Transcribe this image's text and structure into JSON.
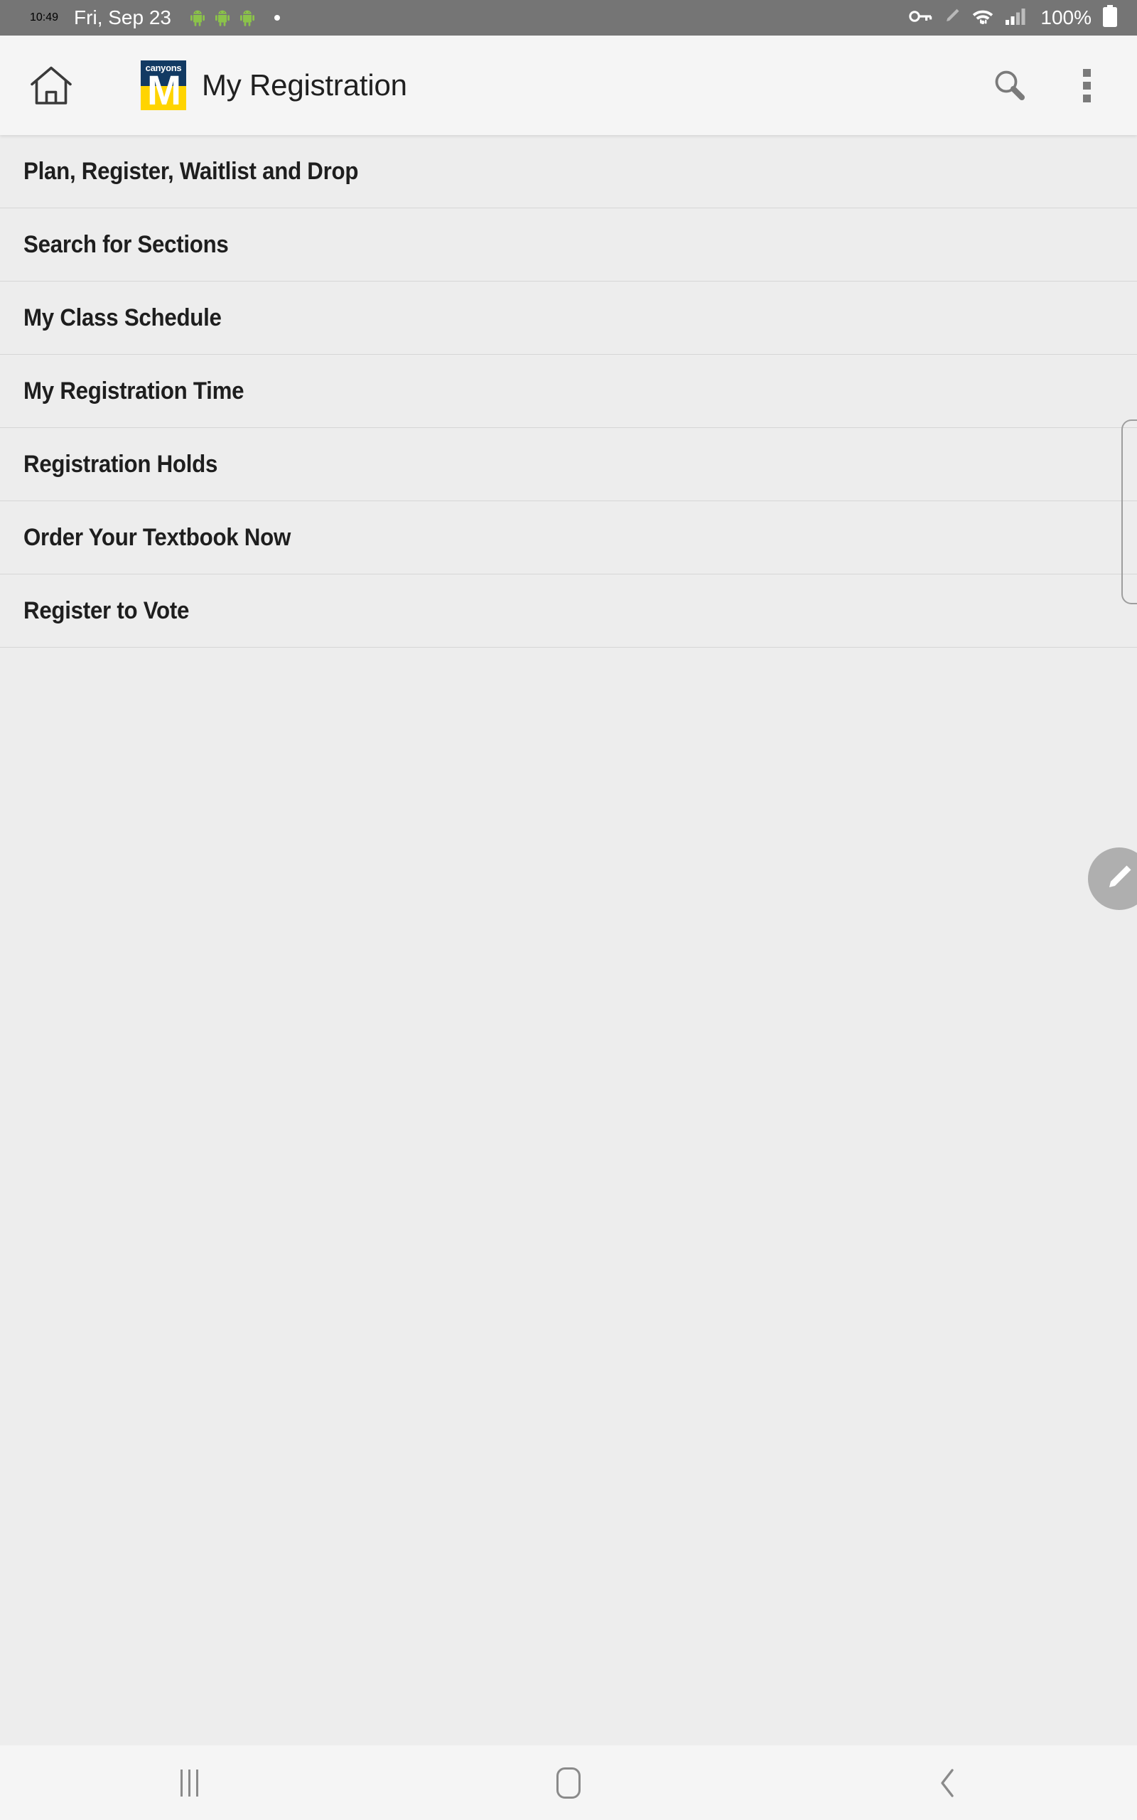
{
  "status_bar": {
    "time": "10:49",
    "date": "Fri, Sep 23",
    "notification_icons": [
      "android-robot-icon",
      "android-robot-icon",
      "android-robot-icon",
      "notification-dot-icon"
    ],
    "right_icons": [
      "vpn-key-icon",
      "pencil-icon",
      "wifi-transfer-icon",
      "cellular-signal-icon"
    ],
    "battery_percent": "100%",
    "battery_icon": "battery-full-icon",
    "background_color": "#757575",
    "text_color": "#FFFFFF"
  },
  "app_bar": {
    "home_icon": "home-icon",
    "logo": {
      "wordmark": "canyons",
      "letter": "M",
      "top_color": "#123A63",
      "bottom_color": "#FFD400"
    },
    "title": "My Registration",
    "search_icon": "search-icon",
    "overflow_icon": "more-vertical-icon",
    "background_color": "#F5F5F5"
  },
  "list": {
    "items": [
      {
        "label": "Plan, Register, Waitlist and Drop"
      },
      {
        "label": "Search for Sections"
      },
      {
        "label": "My Class Schedule"
      },
      {
        "label": "My Registration Time"
      },
      {
        "label": "Registration Holds"
      },
      {
        "label": "Order Your Textbook Now"
      },
      {
        "label": "Register to Vote"
      }
    ],
    "background_color": "#EDEDED",
    "divider_color": "#D6D6D6"
  },
  "scrollbar": {
    "name": "vertical-scrollbar"
  },
  "fab": {
    "icon": "edit-pencil-icon",
    "background_color": "#AFAFAF"
  },
  "nav_bar": {
    "recents_icon": "recent-apps-icon",
    "home_icon": "nav-home-icon",
    "back_icon": "nav-back-icon",
    "background_color": "#F5F5F5"
  }
}
